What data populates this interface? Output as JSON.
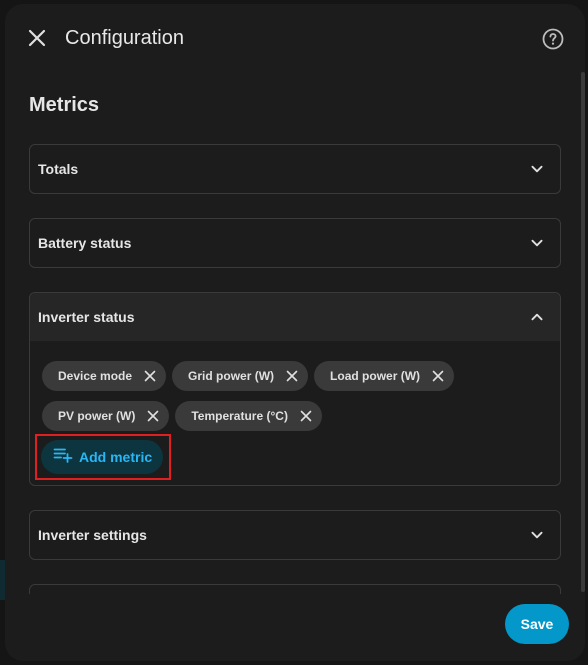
{
  "dialog": {
    "title": "Configuration",
    "close_icon": "close-icon",
    "help_icon": "help-circle-icon"
  },
  "section": {
    "title": "Metrics"
  },
  "panels": [
    {
      "label": "Totals",
      "expanded": false
    },
    {
      "label": "Battery status",
      "expanded": false
    },
    {
      "label": "Inverter status",
      "expanded": true
    },
    {
      "label": "Inverter settings",
      "expanded": false
    },
    {
      "label": "",
      "expanded": false
    }
  ],
  "inverter_status": {
    "chips": [
      "Device mode",
      "Grid power (W)",
      "Load power (W)",
      "PV power (W)",
      "Temperature (°C)"
    ],
    "add_label": "Add metric",
    "add_icon": "playlist-add-icon"
  },
  "footer": {
    "save_label": "Save"
  },
  "colors": {
    "accent": "#0398c9",
    "highlight_border": "#e02020",
    "link": "#29b6f6"
  }
}
